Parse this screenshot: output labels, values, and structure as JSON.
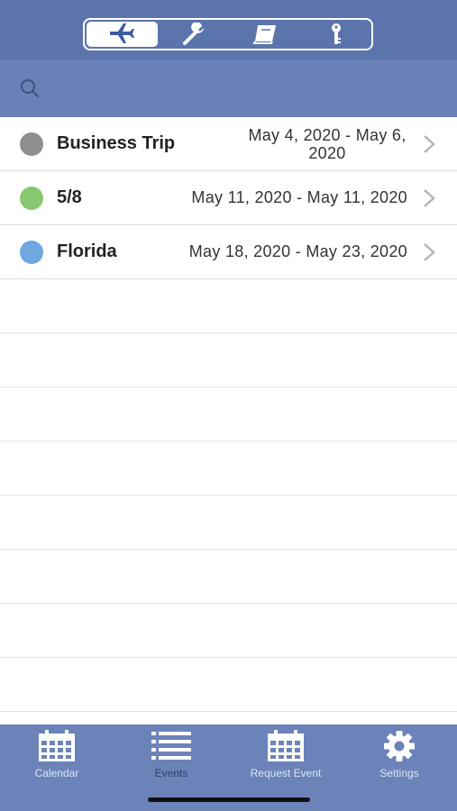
{
  "top_segments": [
    {
      "icon": "airplane-icon",
      "active": true
    },
    {
      "icon": "wrench-icon",
      "active": false
    },
    {
      "icon": "book-icon",
      "active": false
    },
    {
      "icon": "key-icon",
      "active": false
    }
  ],
  "search": {
    "placeholder": ""
  },
  "events": [
    {
      "name": "Business Trip",
      "dates": "May 4, 2020 - May 6, 2020",
      "color": "#8e8e8e"
    },
    {
      "name": "5/8",
      "dates": "May 11, 2020 - May 11, 2020",
      "color": "#86c870"
    },
    {
      "name": "Florida",
      "dates": "May 18, 2020 - May 23, 2020",
      "color": "#6fa8e0"
    }
  ],
  "tabs": [
    {
      "label": "Calendar",
      "icon": "calendar-icon",
      "active": false
    },
    {
      "label": "Events",
      "icon": "list-icon",
      "active": true
    },
    {
      "label": "Request Event",
      "icon": "calendar-request-icon",
      "active": false
    },
    {
      "label": "Settings",
      "icon": "gear-icon",
      "active": false
    }
  ],
  "colors": {
    "header": "#5b74ac",
    "tabbar": "#6b83b9",
    "accent": "#3d5aa3"
  }
}
